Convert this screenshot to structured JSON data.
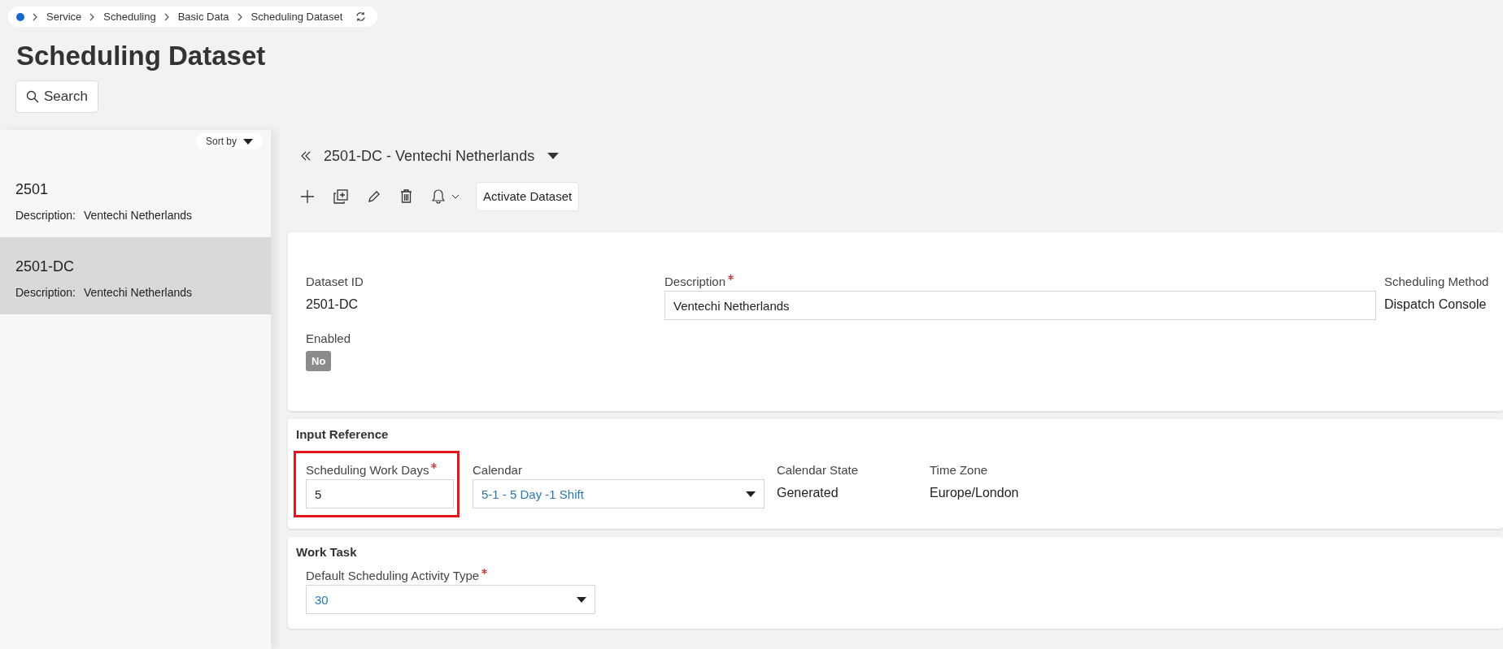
{
  "breadcrumb": {
    "items": [
      "Service",
      "Scheduling",
      "Basic Data",
      "Scheduling Dataset"
    ]
  },
  "page_title": "Scheduling Dataset",
  "search_button": "Search",
  "list": {
    "sort_label": "Sort by",
    "items": [
      {
        "title": "2501",
        "description_label": "Description:",
        "description": "Ventechi Netherlands",
        "selected": false
      },
      {
        "title": "2501-DC",
        "description_label": "Description:",
        "description": "Ventechi Netherlands",
        "selected": true
      }
    ]
  },
  "record": {
    "title": "2501-DC - Ventechi Netherlands",
    "action_button": "Activate Dataset"
  },
  "general": {
    "fields": [
      {
        "kind": "text",
        "label": "Dataset ID",
        "value": "2501-DC",
        "required": false
      },
      {
        "kind": "input",
        "label": "Description",
        "value": "Ventechi Netherlands",
        "required": true
      },
      {
        "kind": "text",
        "label": "Scheduling Method",
        "value": "Dispatch Console",
        "required": false
      },
      {
        "kind": "badge",
        "label": "Enabled",
        "value": "No",
        "on": false,
        "required": false
      }
    ]
  },
  "input_reference": {
    "title": "Input Reference",
    "fields": [
      {
        "kind": "input",
        "label": "Scheduling Work Days",
        "value": "5",
        "required": true,
        "highlighted": true
      },
      {
        "kind": "select",
        "label": "Calendar",
        "value": "5-1 - 5 Day -1 Shift",
        "required": false,
        "highlighted": false
      },
      {
        "kind": "text",
        "label": "Calendar State",
        "value": "Generated",
        "required": false,
        "highlighted": false
      },
      {
        "kind": "text",
        "label": "Time Zone",
        "value": "Europe/London",
        "required": false,
        "highlighted": false
      }
    ]
  },
  "work_task": {
    "title": "Work Task",
    "fields": [
      {
        "kind": "select",
        "label": "Default Scheduling Activity Type",
        "value": "30",
        "required": true
      }
    ]
  }
}
